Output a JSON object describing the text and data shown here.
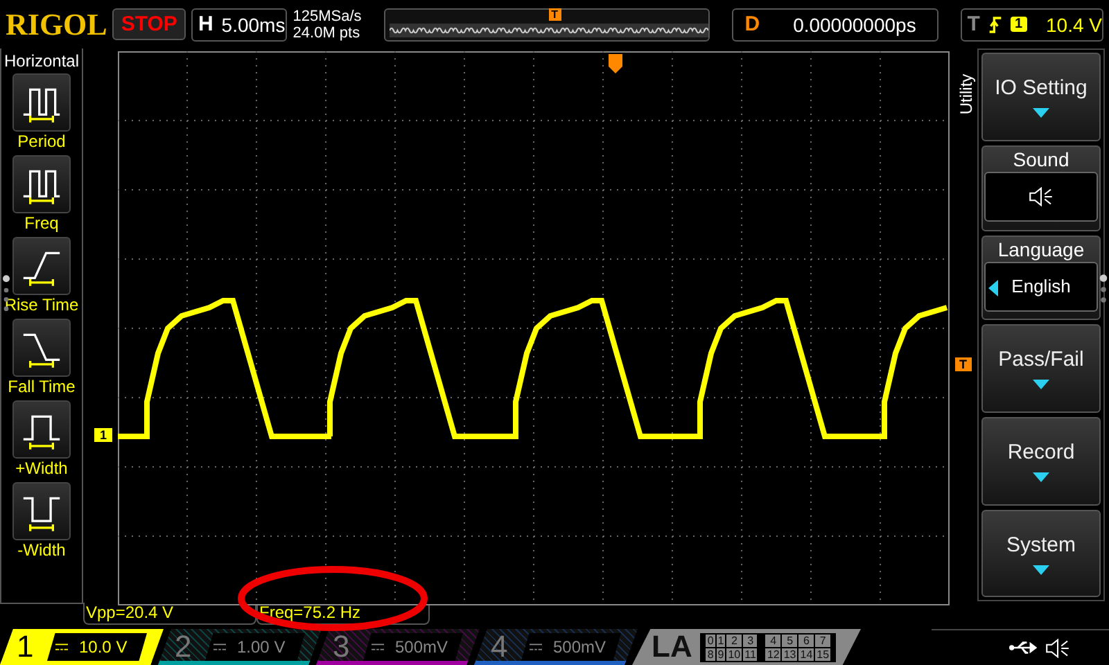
{
  "top_bar": {
    "logo": "RIGOL",
    "run_state": "STOP",
    "timebase": {
      "label": "H",
      "value": "5.00ms"
    },
    "sample_rate": "125MSa/s",
    "memory_depth": "24.0M pts",
    "trigger_position_marker": "T",
    "delay": {
      "label": "D",
      "value": "0.00000000ps"
    },
    "trigger": {
      "label": "T",
      "source": "1",
      "level": "10.4 V"
    }
  },
  "left_menu": {
    "title": "Horizontal",
    "items": [
      {
        "kind": "period",
        "label": "Period"
      },
      {
        "kind": "freq",
        "label": "Freq"
      },
      {
        "kind": "rise",
        "label": "Rise Time"
      },
      {
        "kind": "fall",
        "label": "Fall Time"
      },
      {
        "kind": "pwidth",
        "label": "+Width"
      },
      {
        "kind": "nwidth",
        "label": "-Width"
      }
    ]
  },
  "display": {
    "channel_marker": "1",
    "trigger_level_marker": "T"
  },
  "right_menu": {
    "title": "Utility",
    "items": [
      {
        "kind": "submenu",
        "label": "IO Setting"
      },
      {
        "kind": "sound",
        "label": "Sound",
        "on": true
      },
      {
        "kind": "value",
        "label": "Language",
        "value": "English"
      },
      {
        "kind": "submenu",
        "label": "Pass/Fail"
      },
      {
        "kind": "submenu",
        "label": "Record"
      },
      {
        "kind": "submenu",
        "label": "System"
      }
    ]
  },
  "measurements": [
    "Vpp=20.4 V",
    "Freq=75.2 Hz"
  ],
  "channels": [
    {
      "number": "1",
      "scale": "10.0 V",
      "selected": true,
      "color": "#ffff00"
    },
    {
      "number": "2",
      "scale": "1.00 V",
      "selected": false,
      "color": "#00a0a0"
    },
    {
      "number": "3",
      "scale": "500mV",
      "selected": false,
      "color": "#a000a0"
    },
    {
      "number": "4",
      "scale": "500mV",
      "selected": false,
      "color": "#2060c0"
    }
  ],
  "logic_analyzer": {
    "label": "LA",
    "channels": [
      "0",
      "1",
      "2",
      "3",
      "4",
      "5",
      "6",
      "7",
      "8",
      "9",
      "10",
      "11",
      "12",
      "13",
      "14",
      "15"
    ]
  }
}
